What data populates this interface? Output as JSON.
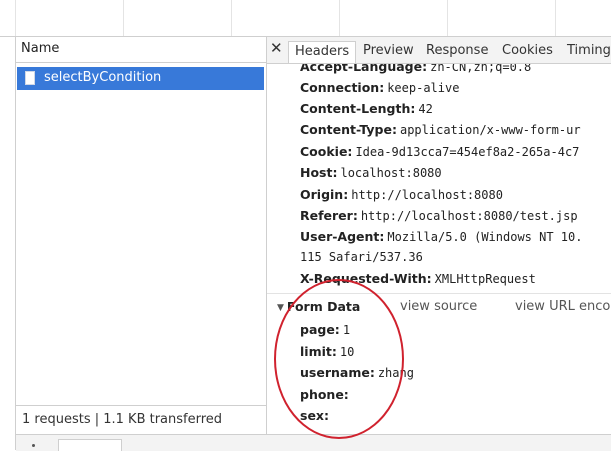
{
  "request_list": {
    "column_header": "Name",
    "requests": [
      {
        "name": "selectByCondition",
        "icon": "document-icon",
        "selected": true
      }
    ],
    "summary": "1 requests  |  1.1 KB transferred"
  },
  "detail_tabs": {
    "close_glyph": "✕",
    "tabs": [
      "Headers",
      "Preview",
      "Response",
      "Cookies",
      "Timing"
    ],
    "active": "Headers"
  },
  "request_headers": [
    {
      "key": "Accept-Language:",
      "value": "zh-CN,zh;q=0.8"
    },
    {
      "key": "Connection:",
      "value": "keep-alive"
    },
    {
      "key": "Content-Length:",
      "value": "42"
    },
    {
      "key": "Content-Type:",
      "value": "application/x-www-form-ur"
    },
    {
      "key": "Cookie:",
      "value": "Idea-9d13cca7=454ef8a2-265a-4c7"
    },
    {
      "key": "Host:",
      "value": "localhost:8080"
    },
    {
      "key": "Origin:",
      "value": "http://localhost:8080"
    },
    {
      "key": "Referer:",
      "value": "http://localhost:8080/test.jsp"
    },
    {
      "key": "User-Agent:",
      "value": "Mozilla/5.0 (Windows NT 10."
    },
    {
      "key": "",
      "value": "115 Safari/537.36"
    },
    {
      "key": "X-Requested-With:",
      "value": "XMLHttpRequest"
    }
  ],
  "form_data": {
    "title": "Form Data",
    "view_source": "view source",
    "view_url_encoded": "view URL enco",
    "fields": [
      {
        "key": "page:",
        "value": "1"
      },
      {
        "key": "limit:",
        "value": "10"
      },
      {
        "key": "username:",
        "value": "zhang"
      },
      {
        "key": "phone:",
        "value": ""
      },
      {
        "key": "sex:",
        "value": ""
      }
    ]
  },
  "colors": {
    "selection": "#3879d9",
    "annotation": "#d0222e",
    "border": "#cfcfcf",
    "toolbar": "#f3f3f3"
  }
}
